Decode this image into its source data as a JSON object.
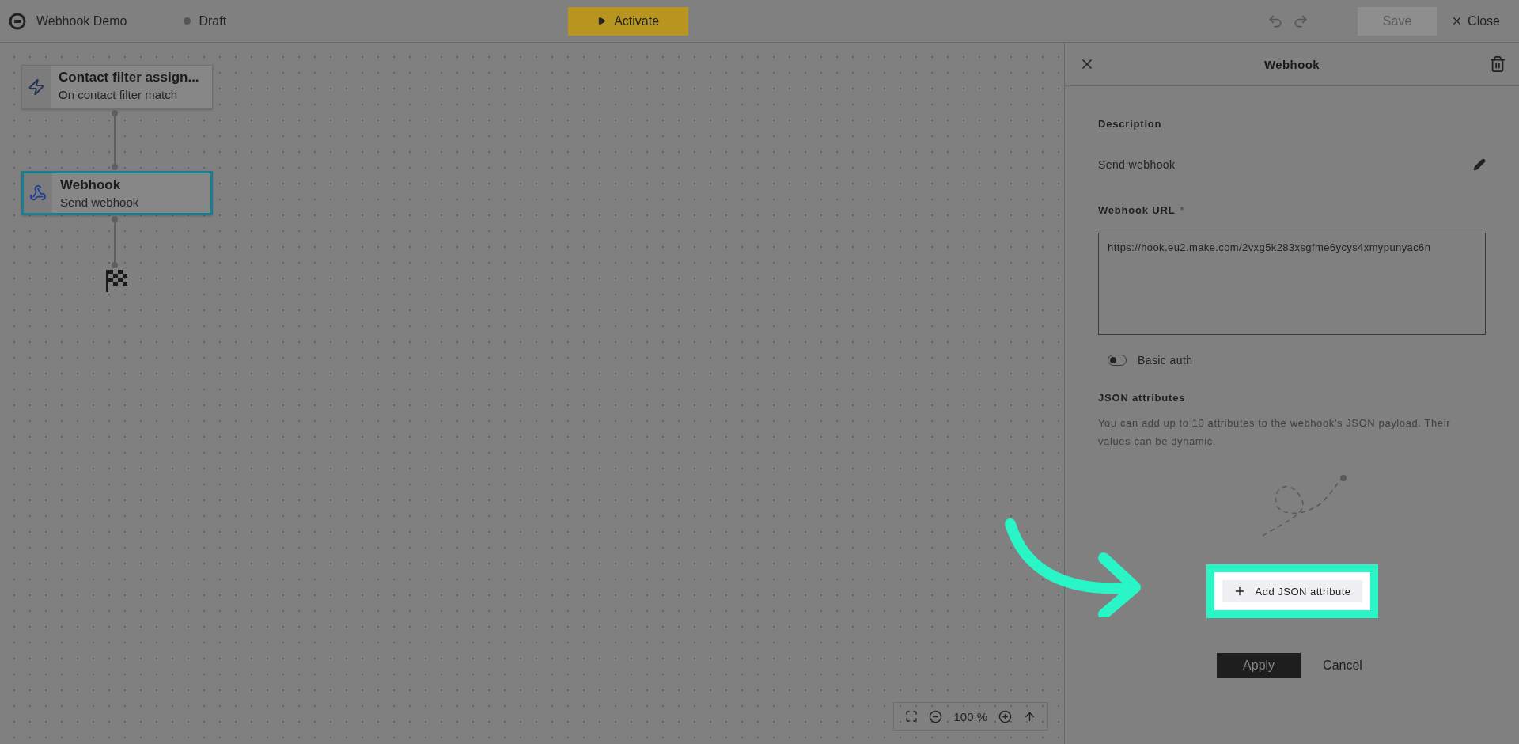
{
  "topbar": {
    "app_title": "Webhook Demo",
    "status": "Draft",
    "activate": "Activate",
    "save": {
      "label": "Save",
      "disabled": true
    },
    "close": "Close"
  },
  "canvas": {
    "nodes": [
      {
        "kind": "trigger",
        "title": "Contact filter assign...",
        "subtitle": "On contact filter match",
        "selected": false
      },
      {
        "kind": "webhook",
        "title": "Webhook",
        "subtitle": "Send webhook",
        "selected": true
      }
    ],
    "zoom": "100 %"
  },
  "panel": {
    "title": "Webhook",
    "description_label": "Description",
    "description": "Send webhook",
    "url_label": "Webhook URL",
    "required_mark": "*",
    "url": "https://hook.eu2.make.com/2vxg5k283xsgfme6ycys4xmypunyac6n",
    "basic_auth": {
      "label": "Basic auth",
      "on": false
    },
    "json_label": "JSON attributes",
    "json_help": "You can add up to 10 attributes to the webhook's JSON payload. Their values can be dynamic.",
    "add_button": "Add JSON attribute",
    "highlighted": true,
    "apply": "Apply",
    "cancel": "Cancel"
  }
}
